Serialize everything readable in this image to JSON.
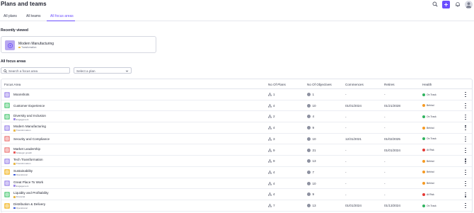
{
  "header": {
    "title": "Plans and teams",
    "actions": [
      {
        "icon": "search-icon"
      },
      {
        "icon": "plus-icon",
        "color": "#6b4eff"
      },
      {
        "icon": "bell-icon"
      },
      {
        "icon": "user-avatar-icon"
      }
    ]
  },
  "tabs": [
    {
      "label": "All plans",
      "active": false
    },
    {
      "label": "All teams",
      "active": false
    },
    {
      "label": "All focus areas",
      "active": true
    }
  ],
  "recently_viewed": {
    "heading": "Recently viewed",
    "item": {
      "name": "Modern Manufacturing",
      "tag": "Transformation",
      "tag_color": "#e8b84a",
      "thumb_color": "#b8a8f0"
    }
  },
  "all_focus_areas": {
    "heading": "All focus areas",
    "search_placeholder": "Search a focus area",
    "plan_select": "Select a plan"
  },
  "table": {
    "columns": [
      "Focus Area",
      "No Of Plans",
      "No Of Objectives",
      "Commences",
      "Retires",
      "Health"
    ],
    "rows": [
      {
        "name": "Moonshots",
        "tag": "",
        "tag_color": "",
        "icon_color": "#b8a8f0",
        "plans": "1",
        "objectives": "1",
        "commences": "-",
        "retires": "-",
        "health": "On Track",
        "health_color": "#2fb35e"
      },
      {
        "name": "Customer Experience",
        "tag": "",
        "tag_color": "",
        "icon_color": "#7fd89c",
        "plans": "4",
        "objectives": "10",
        "commences": "01/01/2024",
        "retires": "01/21/2028",
        "health": "Behind",
        "health_color": "#f59a23"
      },
      {
        "name": "Diversity and Inclusion",
        "tag": "Engagement",
        "tag_color": "#a08ce8",
        "icon_color": "#7fd89c",
        "plans": "2",
        "objectives": "4",
        "commences": "-",
        "retires": "-",
        "health": "On Track",
        "health_color": "#2fb35e"
      },
      {
        "name": "Modern Manufacturing",
        "tag": "Transformation",
        "tag_color": "#e8b84a",
        "icon_color": "#b8a8f0",
        "plans": "4",
        "objectives": "9",
        "commences": "-",
        "retires": "-",
        "health": "Behind",
        "health_color": "#f59a23"
      },
      {
        "name": "Security and Compliance",
        "tag": "",
        "tag_color": "",
        "icon_color": "#f2a0a0",
        "plans": "3",
        "objectives": "10",
        "commences": "12/31/2021",
        "retires": "01/02/2025",
        "health": "On Track",
        "health_color": "#2fb35e"
      },
      {
        "name": "Market Leadership",
        "tag": "Strategic growth",
        "tag_color": "#e85a5a",
        "icon_color": "#f2a0a0",
        "plans": "9",
        "objectives": "21",
        "commences": "-",
        "retires": "01/01/2024",
        "health": "At Risk",
        "health_color": "#e53935"
      },
      {
        "name": "Tech Transformation",
        "tag": "Transformation",
        "tag_color": "#e8b84a",
        "icon_color": "#b8a8f0",
        "plans": "9",
        "objectives": "13",
        "commences": "-",
        "retires": "-",
        "health": "Behind",
        "health_color": "#f59a23"
      },
      {
        "name": "Sustainability",
        "tag": "Operational",
        "tag_color": "#3b5bdb",
        "icon_color": "#f5c85a",
        "plans": "4",
        "objectives": "7",
        "commences": "-",
        "retires": "-",
        "health": "Behind",
        "health_color": "#f59a23"
      },
      {
        "name": "Great Place To Work",
        "tag": "Engagement",
        "tag_color": "#a08ce8",
        "icon_color": "#b8a8f0",
        "plans": "4",
        "objectives": "10",
        "commences": "-",
        "retires": "-",
        "health": "Behind",
        "health_color": "#f59a23"
      },
      {
        "name": "Liquidity and Profitability",
        "tag": "Financial",
        "tag_color": "#e8b84a",
        "icon_color": "#7fd89c",
        "plans": "4",
        "objectives": "9",
        "commences": "-",
        "retires": "-",
        "health": "At Risk",
        "health_color": "#e53935"
      },
      {
        "name": "Distribution & Delivery",
        "tag": "Operational",
        "tag_color": "#3b5bdb",
        "icon_color": "#f5c85a",
        "plans": "7",
        "objectives": "13",
        "commences": "01/01/2024",
        "retires": "01/13/2024",
        "health": "On Track",
        "health_color": "#2fb35e"
      }
    ]
  }
}
